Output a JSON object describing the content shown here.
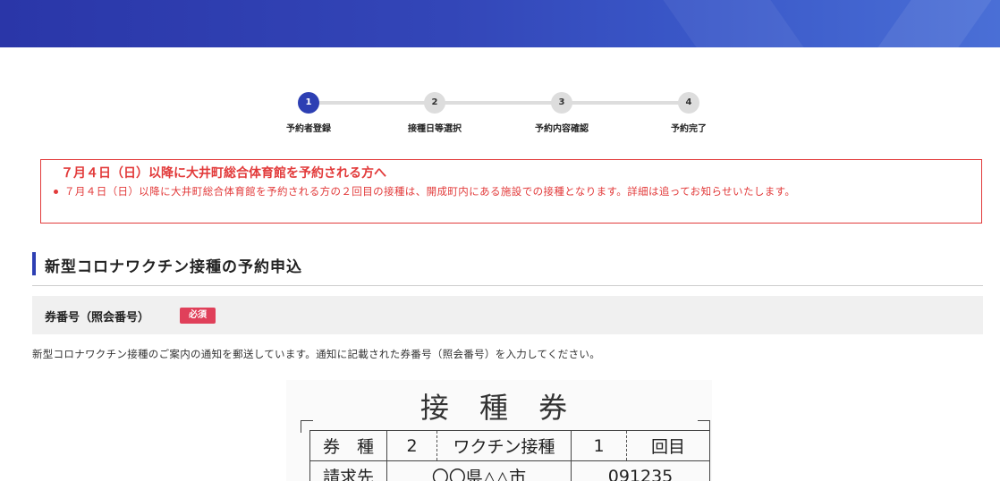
{
  "stepper": {
    "steps": [
      {
        "num": "1",
        "label": "予約者登録"
      },
      {
        "num": "2",
        "label": "接種日等選択"
      },
      {
        "num": "3",
        "label": "予約内容確認"
      },
      {
        "num": "4",
        "label": "予約完了"
      }
    ]
  },
  "notice": {
    "title": "７月４日（日）以降に大井町総合体育館を予約される方へ",
    "item": "７月４日（日）以降に大井町総合体育館を予約される方の２回目の接種は、開成町内にある施設での接種となります。詳細は追ってお知らせいたします。"
  },
  "section": {
    "title": "新型コロナワクチン接種の予約申込"
  },
  "field": {
    "label": "券番号（照会番号）",
    "required_badge": "必須",
    "help": "新型コロナワクチン接種のご案内の通知を郵送しています。通知に記載された券番号（照会番号）を入力してください。"
  },
  "ticket_image": {
    "title": "接 種 券",
    "row1": [
      "券　種",
      "2",
      "ワクチン接種",
      "1",
      "回目"
    ],
    "row2": [
      "請求先",
      "〇〇県△△市",
      "091235"
    ]
  },
  "colors": {
    "accent": "#2d3fb3",
    "alert": "#e23a3a",
    "required": "#e0405a"
  }
}
